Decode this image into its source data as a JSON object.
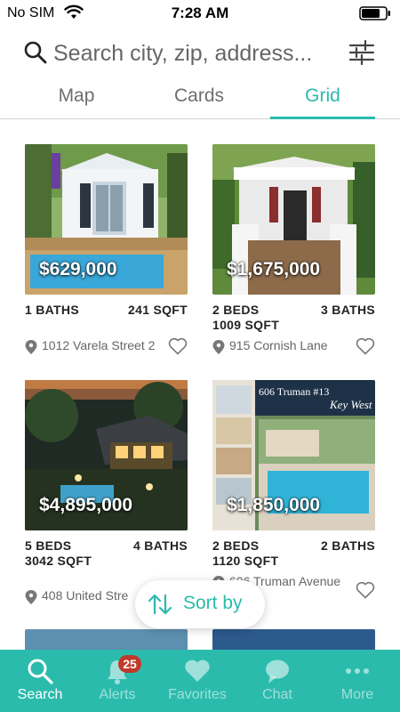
{
  "status_bar": {
    "carrier": "No SIM",
    "time": "7:28 AM"
  },
  "search": {
    "placeholder": "Search city, zip, address..."
  },
  "tabs": [
    {
      "label": "Map",
      "active": false
    },
    {
      "label": "Cards",
      "active": false
    },
    {
      "label": "Grid",
      "active": true
    }
  ],
  "listings": [
    {
      "price": "$629,000",
      "left_spec": "1 BATHS",
      "right_spec": "241 SQFT",
      "address": "1012 Varela Street 2"
    },
    {
      "price": "$1,675,000",
      "left_spec": "2 BEDS",
      "left_spec2": "1009 SQFT",
      "right_spec": "3 BATHS",
      "address": "915 Cornish Lane"
    },
    {
      "price": "$4,895,000",
      "left_spec": "5 BEDS",
      "left_spec2": "3042 SQFT",
      "right_spec": "4 BATHS",
      "address": "408 United Stre"
    },
    {
      "price": "$1,850,000",
      "left_spec": "2 BEDS",
      "left_spec2": "1120 SQFT",
      "right_spec": "2 BATHS",
      "address": "606 Truman Avenue",
      "photo_text": "606 Truman #13",
      "photo_text2": "Key West"
    }
  ],
  "sort": {
    "label": "Sort by"
  },
  "nav": [
    {
      "label": "Search",
      "icon": "search-icon",
      "active": true
    },
    {
      "label": "Alerts",
      "icon": "bell-icon",
      "badge": "25"
    },
    {
      "label": "Favorites",
      "icon": "heart-icon"
    },
    {
      "label": "Chat",
      "icon": "chat-bubble-icon"
    },
    {
      "label": "More",
      "icon": "more-dots-icon"
    }
  ],
  "colors": {
    "accent": "#2bbbad",
    "badge": "#c0392b",
    "text_dark": "#222222",
    "text_muted": "#666666"
  }
}
